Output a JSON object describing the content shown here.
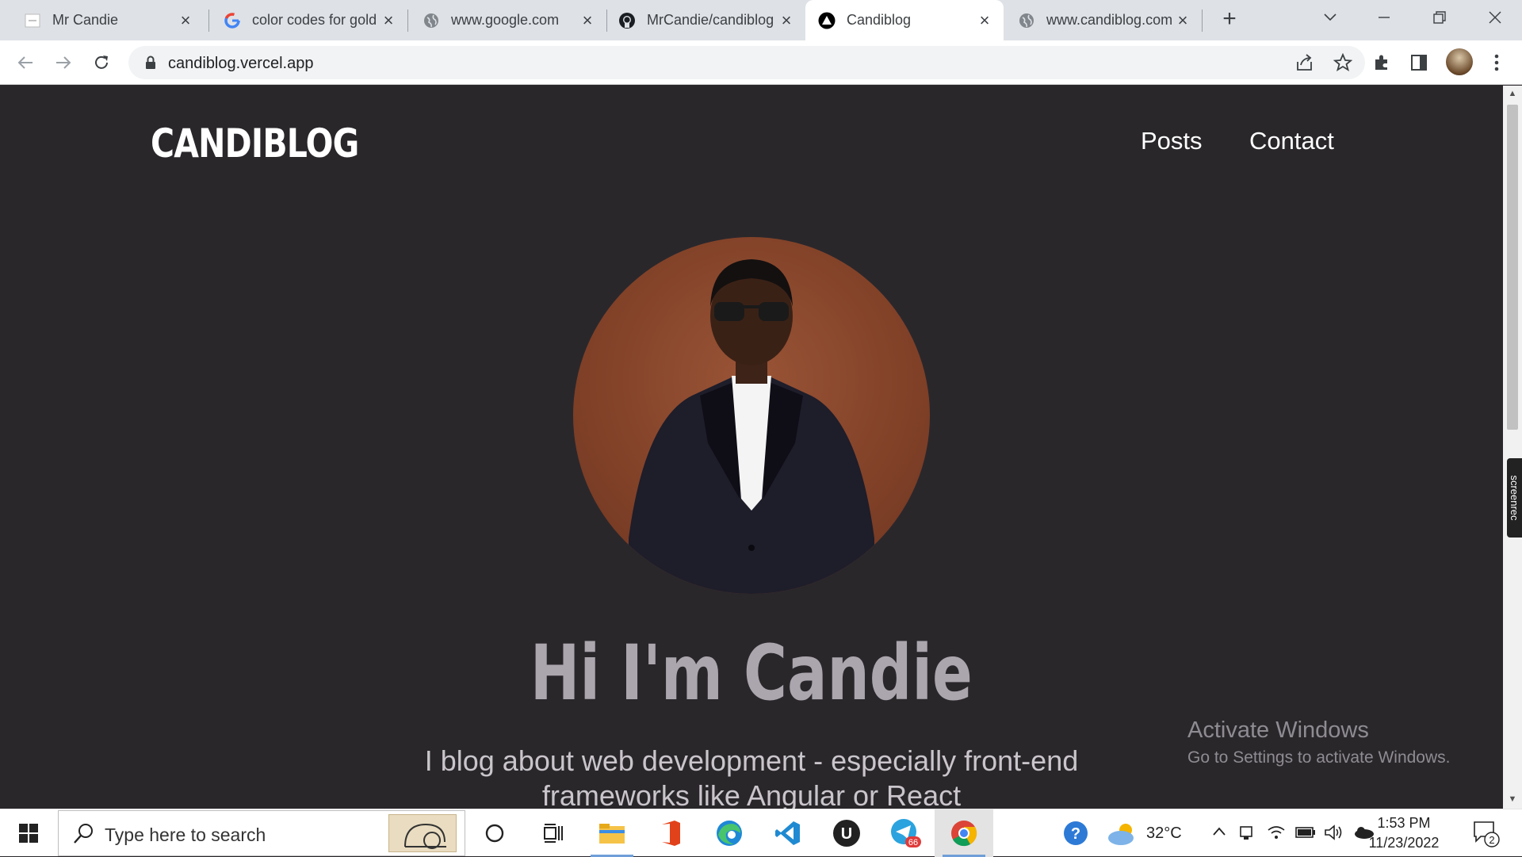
{
  "browser": {
    "tabs": [
      {
        "title": "Mr Candie",
        "icon": "page-icon",
        "active": false
      },
      {
        "title": "color codes for gold",
        "icon": "google-icon",
        "active": false
      },
      {
        "title": "www.google.com",
        "icon": "globe-icon",
        "active": false
      },
      {
        "title": "MrCandie/candiblog",
        "icon": "github-icon",
        "active": false
      },
      {
        "title": "Candiblog",
        "icon": "vercel-icon",
        "active": true
      },
      {
        "title": "www.candiblog.com",
        "icon": "globe-icon",
        "active": false
      }
    ],
    "url": "candiblog.vercel.app"
  },
  "site": {
    "logo": "CANDIBLOG",
    "nav": [
      "Posts",
      "Contact"
    ],
    "headline": "Hi I'm Candie",
    "subtitle": "I blog about web development - especially front-end frameworks like Angular or React",
    "avatar_alt": "profile-photo"
  },
  "watermark": {
    "line1": "Activate Windows",
    "line2": "Go to Settings to activate Windows."
  },
  "screenrec_label": "screenrec",
  "taskbar": {
    "search_placeholder": "Type here to search",
    "telegram_badge": "66",
    "weather": "32°C",
    "time": "1:53 PM",
    "date": "11/23/2022",
    "notification_count": "2"
  },
  "colors": {
    "page_bg": "#2a272b",
    "headline": "#aba6ae",
    "avatar_bg": "#8a4a30"
  }
}
